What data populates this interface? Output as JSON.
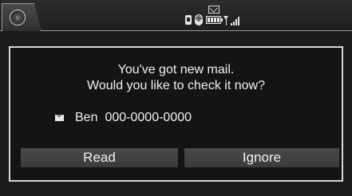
{
  "status_bar": {
    "home_icon": "home-circle-icon",
    "icons": [
      "mail-icon",
      "phone-icon",
      "bluetooth-icon",
      "battery-icon",
      "signal-icon"
    ]
  },
  "dialog": {
    "line1": "You've got new mail.",
    "line2": "Would you like to check it now?",
    "sender": {
      "icon": "envelope-icon",
      "name": "Ben",
      "number": "000-0000-0000"
    },
    "buttons": {
      "read": "Read",
      "ignore": "Ignore"
    }
  },
  "colors": {
    "background": "#1b1b1b",
    "border": "#d8d8d8",
    "button": "#444444",
    "text": "#f2f2f2"
  }
}
